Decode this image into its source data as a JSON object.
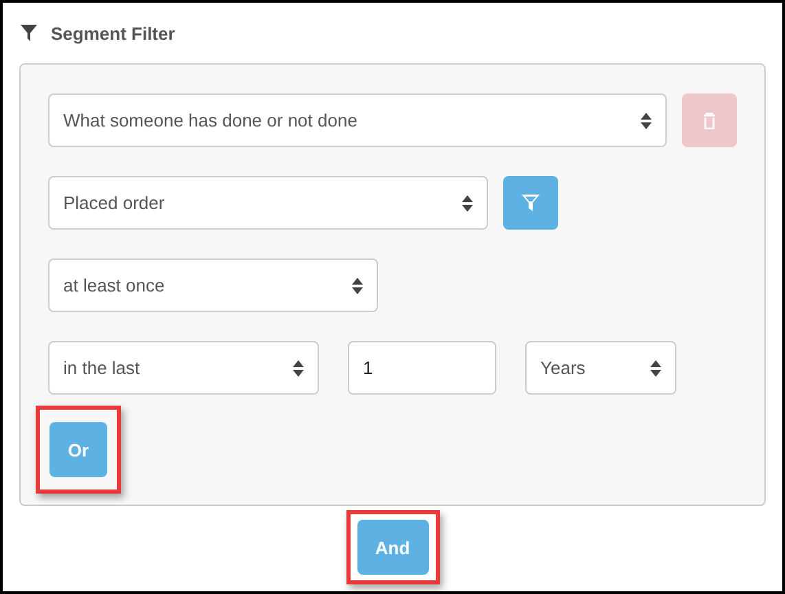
{
  "header": {
    "title": "Segment Filter"
  },
  "condition_rows": [
    {
      "fields": [
        {
          "kind": "select",
          "value": "What someone has done or not done"
        }
      ],
      "action": {
        "kind": "delete",
        "disabled": true
      }
    },
    {
      "fields": [
        {
          "kind": "select",
          "value": "Placed order"
        }
      ],
      "action": {
        "kind": "filter",
        "disabled": false
      }
    },
    {
      "fields": [
        {
          "kind": "select",
          "value": "at least once"
        }
      ]
    },
    {
      "fields": [
        {
          "kind": "select",
          "value": "in the last"
        },
        {
          "kind": "input",
          "value": "1"
        },
        {
          "kind": "select",
          "value": "Years"
        }
      ]
    }
  ],
  "or_button": {
    "label": "Or",
    "highlighted": true
  },
  "and_button": {
    "label": "And",
    "highlighted": true
  }
}
